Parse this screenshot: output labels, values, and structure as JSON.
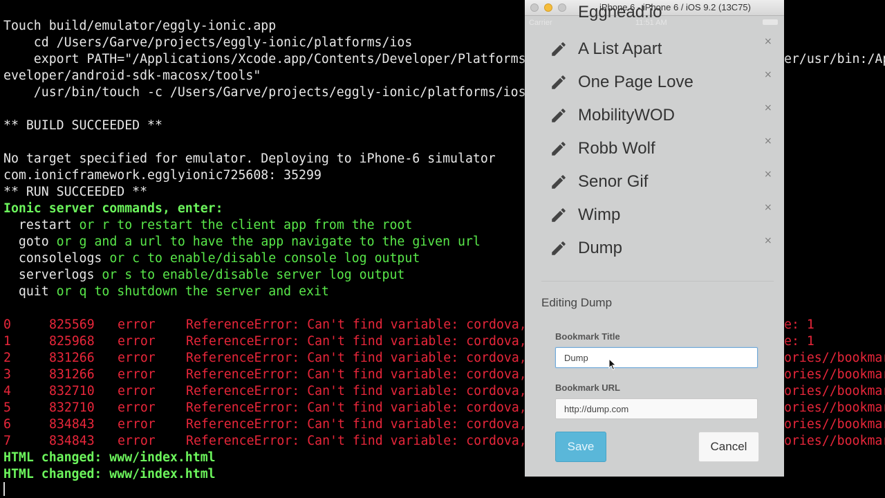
{
  "terminal": {
    "lines": [
      "Touch build/emulator/eggly-ionic.app",
      "    cd /Users/Garve/projects/eggly-ionic/platforms/ios",
      "    export PATH=\"/Applications/Xcode.app/Contents/Developer/Platforms",
      "eveloper/android-sdk-macosx/tools\"",
      "    /usr/bin/touch -c /Users/Garve/projects/eggly-ionic/platforms/ios",
      "** BUILD SUCCEEDED **",
      "No target specified for emulator. Deploying to iPhone-6 simulator",
      "com.ionicframework.egglyionic725608: 35299",
      "** RUN SUCCEEDED **"
    ],
    "path_right_fragment": "er/usr/bin:/Ap",
    "ionic_heading": "Ionic server commands, enter:",
    "commands": [
      {
        "cmd": "restart",
        "short": "or r",
        "desc": "to restart the client app from the root"
      },
      {
        "cmd": "goto",
        "short": "or g",
        "desc": "and a url to have the app navigate to the given url"
      },
      {
        "cmd": "consolelogs",
        "short": "or c",
        "desc": "to enable/disable console log output"
      },
      {
        "cmd": "serverlogs",
        "short": "or s",
        "desc": "to enable/disable server log output"
      },
      {
        "cmd": "quit",
        "short": "or q",
        "desc": "to shutdown the server and exit"
      }
    ],
    "errors": [
      {
        "idx": "0",
        "time": "825569",
        "level": "error",
        "msg": "ReferenceError: Can't find variable: cordova,",
        "right": "e: 1"
      },
      {
        "idx": "1",
        "time": "825968",
        "level": "error",
        "msg": "ReferenceError: Can't find variable: cordova,",
        "right": "e: 1"
      },
      {
        "idx": "2",
        "time": "831266",
        "level": "error",
        "msg": "ReferenceError: Can't find variable: cordova,",
        "right": "ories//bookmar"
      },
      {
        "idx": "3",
        "time": "831266",
        "level": "error",
        "msg": "ReferenceError: Can't find variable: cordova,",
        "right": "ories//bookmar"
      },
      {
        "idx": "4",
        "time": "832710",
        "level": "error",
        "msg": "ReferenceError: Can't find variable: cordova,",
        "right": "ories//bookmar"
      },
      {
        "idx": "5",
        "time": "832710",
        "level": "error",
        "msg": "ReferenceError: Can't find variable: cordova,",
        "right": "ories//bookmar"
      },
      {
        "idx": "6",
        "time": "834843",
        "level": "error",
        "msg": "ReferenceError: Can't find variable: cordova,",
        "right": "ories//bookmar"
      },
      {
        "idx": "7",
        "time": "834843",
        "level": "error",
        "msg": "ReferenceError: Can't find variable: cordova,",
        "right": "ories//bookmar"
      }
    ],
    "html_changed": [
      "HTML changed: www/index.html",
      "HTML changed: www/index.html"
    ]
  },
  "simulator": {
    "title": "iPhone 6 - iPhone 6 / iOS 9.2 (13C75)",
    "status_carrier": "Carrier",
    "status_time": "11:51 AM",
    "partial_item": "Eggnead.io",
    "bookmarks": [
      "A List Apart",
      "One Page Love",
      "MobilityWOD",
      "Robb Wolf",
      "Senor Gif",
      "Wimp",
      "Dump"
    ],
    "delete_glyph": "×",
    "editing_heading": "Editing Dump",
    "title_label": "Bookmark Title",
    "title_value": "Dump",
    "url_label": "Bookmark URL",
    "url_value": "http://dump.com",
    "save_label": "Save",
    "cancel_label": "Cancel"
  },
  "colors": {
    "terminal_bg": "#000000",
    "terminal_text": "#e8e8e8",
    "green": "#59e84a",
    "red": "#e8263a",
    "save_button": "#5ab7d9",
    "app_bg": "#cfd0d0"
  }
}
